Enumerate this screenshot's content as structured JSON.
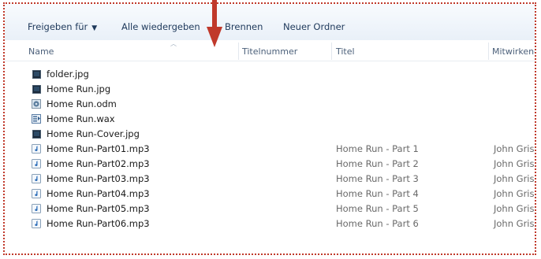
{
  "toolbar": {
    "share_label": "Freigeben für",
    "play_all_label": "Alle wiedergeben",
    "burn_label": "Brennen",
    "new_folder_label": "Neuer Ordner"
  },
  "columns": {
    "name": "Name",
    "track": "Titelnummer",
    "title": "Titel",
    "artist": "Mitwirkende"
  },
  "files": [
    {
      "name": "folder.jpg",
      "icon": "image-file-icon",
      "title": "",
      "artist": ""
    },
    {
      "name": "Home Run.jpg",
      "icon": "image-file-icon",
      "title": "",
      "artist": ""
    },
    {
      "name": "Home Run.odm",
      "icon": "overdrive-file-icon",
      "title": "",
      "artist": ""
    },
    {
      "name": "Home Run.wax",
      "icon": "playlist-file-icon",
      "title": "",
      "artist": ""
    },
    {
      "name": "Home Run-Cover.jpg",
      "icon": "image-file-icon",
      "title": "",
      "artist": ""
    },
    {
      "name": "Home Run-Part01.mp3",
      "icon": "audio-file-icon",
      "title": "Home Run - Part 1",
      "artist": "John Gris"
    },
    {
      "name": "Home Run-Part02.mp3",
      "icon": "audio-file-icon",
      "title": "Home Run - Part 2",
      "artist": "John Gris"
    },
    {
      "name": "Home Run-Part03.mp3",
      "icon": "audio-file-icon",
      "title": "Home Run - Part 3",
      "artist": "John Gris"
    },
    {
      "name": "Home Run-Part04.mp3",
      "icon": "audio-file-icon",
      "title": "Home Run - Part 4",
      "artist": "John Gris"
    },
    {
      "name": "Home Run-Part05.mp3",
      "icon": "audio-file-icon",
      "title": "Home Run - Part 5",
      "artist": "John Grist"
    },
    {
      "name": "Home Run-Part06.mp3",
      "icon": "audio-file-icon",
      "title": "Home Run - Part 6",
      "artist": "John Gris"
    }
  ],
  "colors": {
    "annotation_red": "#c0392b",
    "toolbar_text": "#1e395b"
  }
}
